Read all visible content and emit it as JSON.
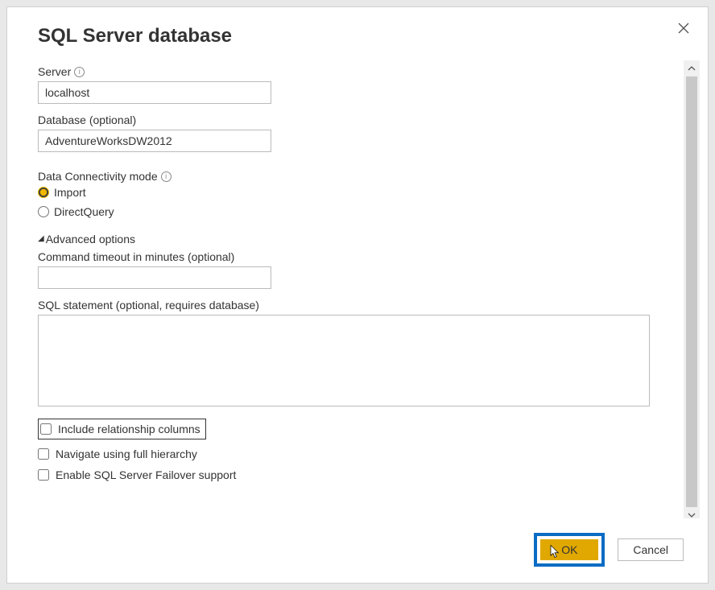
{
  "dialog": {
    "title": "SQL Server database"
  },
  "fields": {
    "server": {
      "label": "Server",
      "value": "localhost"
    },
    "database": {
      "label": "Database (optional)",
      "value": "AdventureWorksDW2012"
    },
    "connectivity": {
      "label": "Data Connectivity mode",
      "options": {
        "import": "Import",
        "directquery": "DirectQuery"
      },
      "selected": "import"
    }
  },
  "advanced": {
    "toggle_label": "Advanced options",
    "command_timeout": {
      "label": "Command timeout in minutes (optional)",
      "value": ""
    },
    "sql_statement": {
      "label": "SQL statement (optional, requires database)",
      "value": ""
    },
    "checkbox1": "Include relationship columns",
    "checkbox2": "Navigate using full hierarchy",
    "checkbox3": "Enable SQL Server Failover support"
  },
  "buttons": {
    "ok": "OK",
    "cancel": "Cancel"
  }
}
